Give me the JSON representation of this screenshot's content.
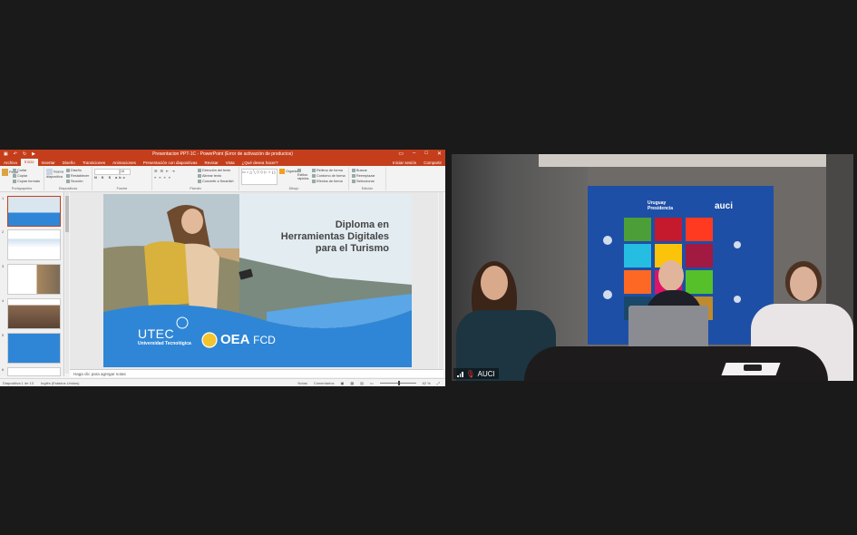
{
  "ppt": {
    "title": "Presentacion PPT-1C - PowerPoint (Error de activación de productos)",
    "tabs": [
      "Archivo",
      "Inicio",
      "Insertar",
      "Diseño",
      "Transiciones",
      "Animaciones",
      "Presentación con diapositivas",
      "Revisar",
      "Vista",
      "¿Qué desea hacer?"
    ],
    "tabs_right": [
      "Iniciar sesión",
      "Compartir"
    ],
    "ribbon_groups": [
      {
        "label": "Portapapeles",
        "items": [
          "Pegar",
          "Cortar",
          "Copiar",
          "Copiar formato"
        ]
      },
      {
        "label": "Diapositivas",
        "items": [
          "Nueva diapositiva",
          "Diseño",
          "Restablecer",
          "Sección"
        ]
      },
      {
        "label": "Fuente",
        "items": []
      },
      {
        "label": "Párrafo",
        "items": [
          "Dirección del texto",
          "Alinear texto",
          "Convertir a SmartArt"
        ]
      },
      {
        "label": "Dibujo",
        "items": [
          "Organizar",
          "Estilos rápidos",
          "Relleno de forma",
          "Contorno de forma",
          "Efectos de forma"
        ]
      },
      {
        "label": "Edición",
        "items": [
          "Buscar",
          "Reemplazar",
          "Seleccionar"
        ]
      }
    ],
    "font_size": "18",
    "thumbnail_numbers": [
      "1",
      "2",
      "3",
      "4",
      "5",
      "6"
    ],
    "slide": {
      "title_lines": [
        "Diploma en",
        "Herramientas Digitales",
        "para el Turismo"
      ],
      "utec": "UTEC",
      "utec_sub": "Universidad Tecnológica",
      "oea": "OEA",
      "fcd": "FCD"
    },
    "notes_placeholder": "Haga clic para agregar notas",
    "status_left": [
      "Diapositiva 1 de 13",
      "Inglés (Estados Unidos)"
    ],
    "status_right": [
      "Notas",
      "Comentarios"
    ],
    "zoom": "62 %"
  },
  "video": {
    "participant_name": "AUCI",
    "backdrop_text": [
      "Uruguay",
      "Presidencia",
      "auci"
    ]
  },
  "colors": {
    "ppt_accent": "#c43e1c",
    "backdrop": "#1e4fa6",
    "slide_wave": "#2f86d6"
  }
}
